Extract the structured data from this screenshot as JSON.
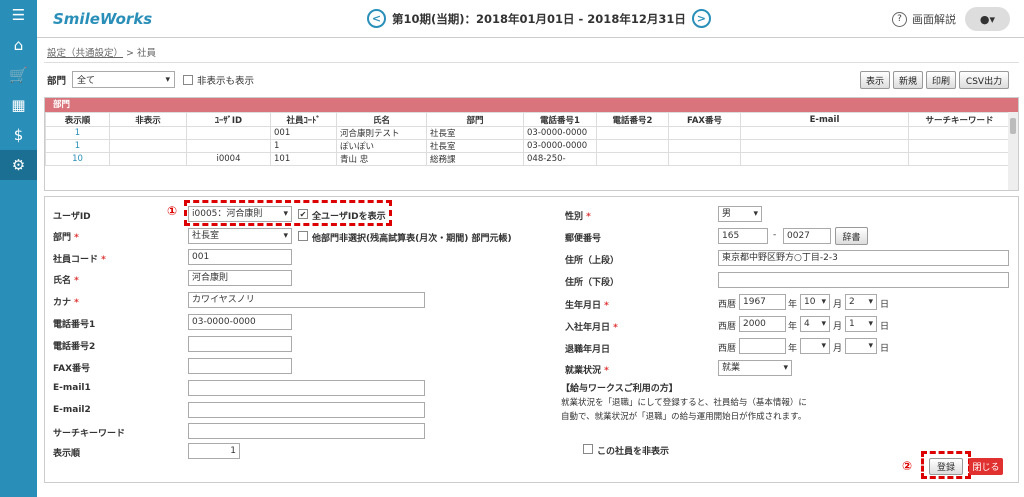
{
  "header": {
    "logo": "SmileWorks",
    "period": "第10期(当期)：2018年01月01日 - 2018年12月31日",
    "prev_icon": "chevron-left-icon",
    "next_icon": "chevron-right-icon",
    "help_label": "画面解説",
    "user_icon": "user-icon"
  },
  "sidebar": {
    "items": [
      {
        "icon": "menu-icon",
        "glyph": "☰"
      },
      {
        "icon": "home-icon",
        "glyph": "⌂"
      },
      {
        "icon": "cart-icon",
        "glyph": "🛒"
      },
      {
        "icon": "calculator-icon",
        "glyph": "▦"
      },
      {
        "icon": "money-bag-icon",
        "glyph": "$"
      },
      {
        "icon": "gear-icon",
        "glyph": "⚙"
      }
    ]
  },
  "breadcrumb": {
    "parent": "設定（共通設定）",
    "sep": ">",
    "current": "社員"
  },
  "filter": {
    "dept_label": "部門",
    "dept_value": "全て",
    "show_hidden_label": "非表示も表示"
  },
  "toolbar": {
    "display": "表示",
    "new": "新規",
    "print": "印刷",
    "csv": "CSV出力"
  },
  "table": {
    "title": "部門",
    "columns": [
      "表示順",
      "非表示",
      "ﾕｰｻﾞID",
      "社員ｺｰﾄﾞ",
      "氏名",
      "部門",
      "電話番号1",
      "電話番号2",
      "FAX番号",
      "E-mail",
      "サーチキーワード"
    ],
    "rows": [
      [
        "1",
        "",
        "",
        "001",
        "河合康則テスト",
        "社長室",
        "03-0000-0000",
        "",
        "",
        "",
        ""
      ],
      [
        "1",
        "",
        "",
        "1",
        "ぽいぽい",
        "社長室",
        "03-0000-0000",
        "",
        "",
        "",
        ""
      ],
      [
        "10",
        "",
        "i0004",
        "101",
        "青山 忠",
        "総務課",
        "048-250-",
        "",
        "",
        "",
        ""
      ]
    ]
  },
  "form": {
    "user_id_label": "ユーザID",
    "user_id_value": "i0005：河合康則",
    "all_user_label": "全ユーザIDを表示",
    "dept_label": "部門",
    "dept_value": "社長室",
    "other_dept_label": "他部門非選択(残高試算表(月次・期間) 部門元帳)",
    "code_label": "社員コード",
    "code_value": "001",
    "name_label": "氏名",
    "name_value": "河合康則",
    "kana_label": "カナ",
    "kana_value": "カワイヤスノリ",
    "tel1_label": "電話番号1",
    "tel1_value": "03-0000-0000",
    "tel2_label": "電話番号2",
    "fax_label": "FAX番号",
    "email1_label": "E-mail1",
    "email2_label": "E-mail2",
    "search_label": "サーチキーワード",
    "order_label": "表示順",
    "order_value": "1",
    "gender_label": "性別",
    "gender_value": "男",
    "zip_label": "郵便番号",
    "zip1": "165",
    "zip_sep": "-",
    "zip2": "0027",
    "dict_btn": "辞書",
    "addr1_label": "住所（上段）",
    "addr1_value": "東京都中野区野方○丁目-2-3",
    "addr2_label": "住所（下段）",
    "birth_label": "生年月日",
    "era": "西暦",
    "birth_y": "1967",
    "birth_m": "10",
    "birth_d": "2",
    "year_unit": "年",
    "month_unit": "月",
    "day_unit": "日",
    "join_label": "入社年月日",
    "join_y": "2000",
    "join_m": "4",
    "join_d": "1",
    "leave_label": "退職年月日",
    "status_label": "就業状況",
    "status_value": "就業",
    "note_title": "【給与ワークスご利用の方】",
    "note_line1": "就業状況を「退職」にして登録すると、社員給与（基本情報）に",
    "note_line2": "自動で、就業状況が「退職」の給与運用開始日が作成されます。",
    "hide_label": "この社員を非表示",
    "save_btn": "登録",
    "close_btn": "閉じる",
    "mark1": "①",
    "mark2": "②",
    "required_mark": "*",
    "caret": "▾",
    "check": "✔"
  },
  "colors": {
    "accent": "#2a8fb8",
    "table_header": "#d9747c",
    "annotation": "#dd0000"
  }
}
